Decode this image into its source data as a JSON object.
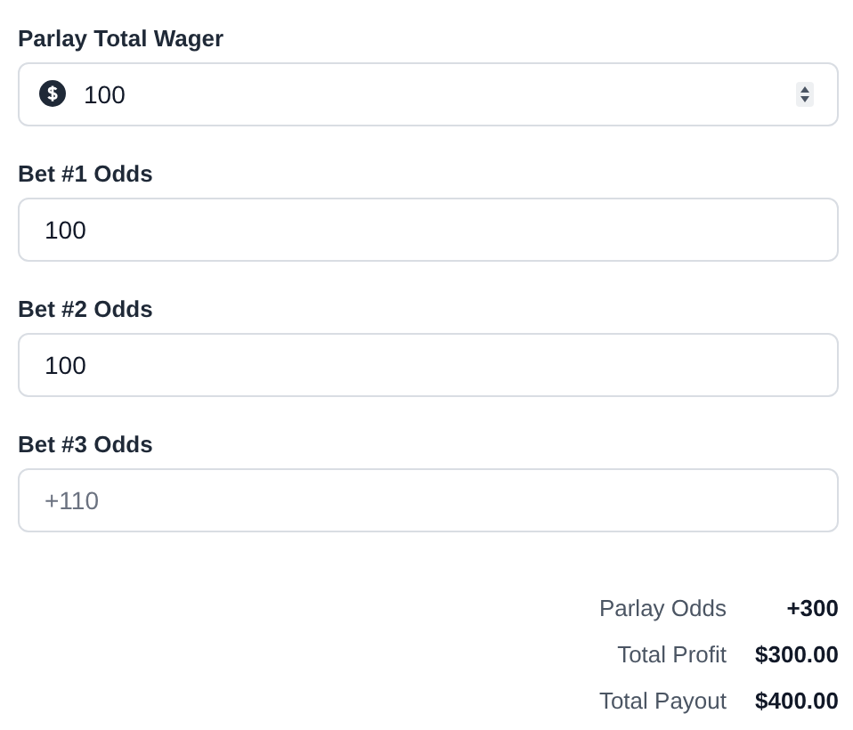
{
  "fields": [
    {
      "kind": "currency",
      "label": "Parlay Total Wager",
      "value": "100"
    },
    {
      "kind": "plain",
      "label": "Bet #1 Odds",
      "value": "100"
    },
    {
      "kind": "plain",
      "label": "Bet #2 Odds",
      "value": "100"
    },
    {
      "kind": "plain",
      "label": "Bet #3 Odds",
      "placeholder": "+110"
    }
  ],
  "results": [
    {
      "label": "Parlay Odds",
      "value": "+300"
    },
    {
      "label": "Total Profit",
      "value": "$300.00"
    },
    {
      "label": "Total Payout",
      "value": "$400.00"
    }
  ]
}
